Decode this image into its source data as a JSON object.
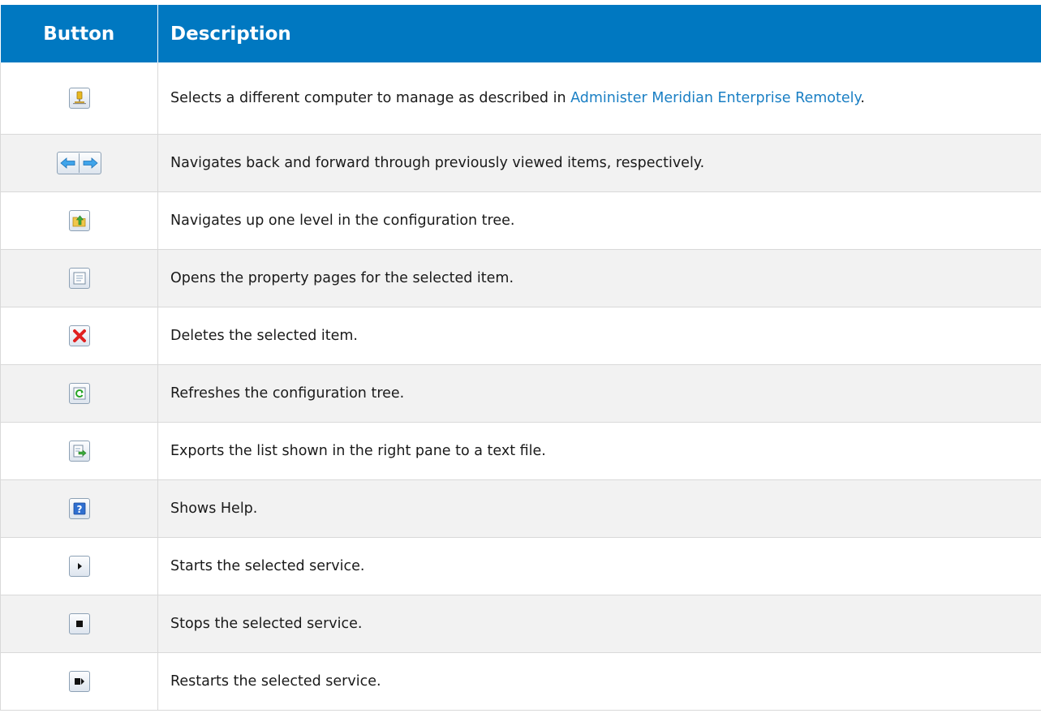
{
  "table": {
    "headers": {
      "button": "Button",
      "description": "Description"
    },
    "rows": [
      {
        "icon": "select-computer-icon",
        "description_before": "Selects a different computer to manage as described in ",
        "link_text": "Administer Meridian Enterprise Remotely",
        "description_after": "."
      },
      {
        "icon": "back-forward-icon",
        "description": "Navigates back and forward through previously viewed items, respectively."
      },
      {
        "icon": "up-one-level-icon",
        "description": "Navigates up one level in the configuration tree."
      },
      {
        "icon": "properties-icon",
        "description": "Opens the property pages for the selected item."
      },
      {
        "icon": "delete-icon",
        "description": "Deletes the selected item."
      },
      {
        "icon": "refresh-icon",
        "description": "Refreshes the configuration tree."
      },
      {
        "icon": "export-list-icon",
        "description": "Exports the list shown in the right pane to a text file."
      },
      {
        "icon": "help-icon",
        "description": "Shows Help."
      },
      {
        "icon": "start-service-icon",
        "description": "Starts the selected service."
      },
      {
        "icon": "stop-service-icon",
        "description": "Stops the selected service."
      },
      {
        "icon": "restart-service-icon",
        "description": "Restarts the selected service."
      }
    ]
  },
  "colors": {
    "header_background": "#0078c1",
    "link": "#1a7fc4",
    "alt_row": "#f2f2f2"
  }
}
